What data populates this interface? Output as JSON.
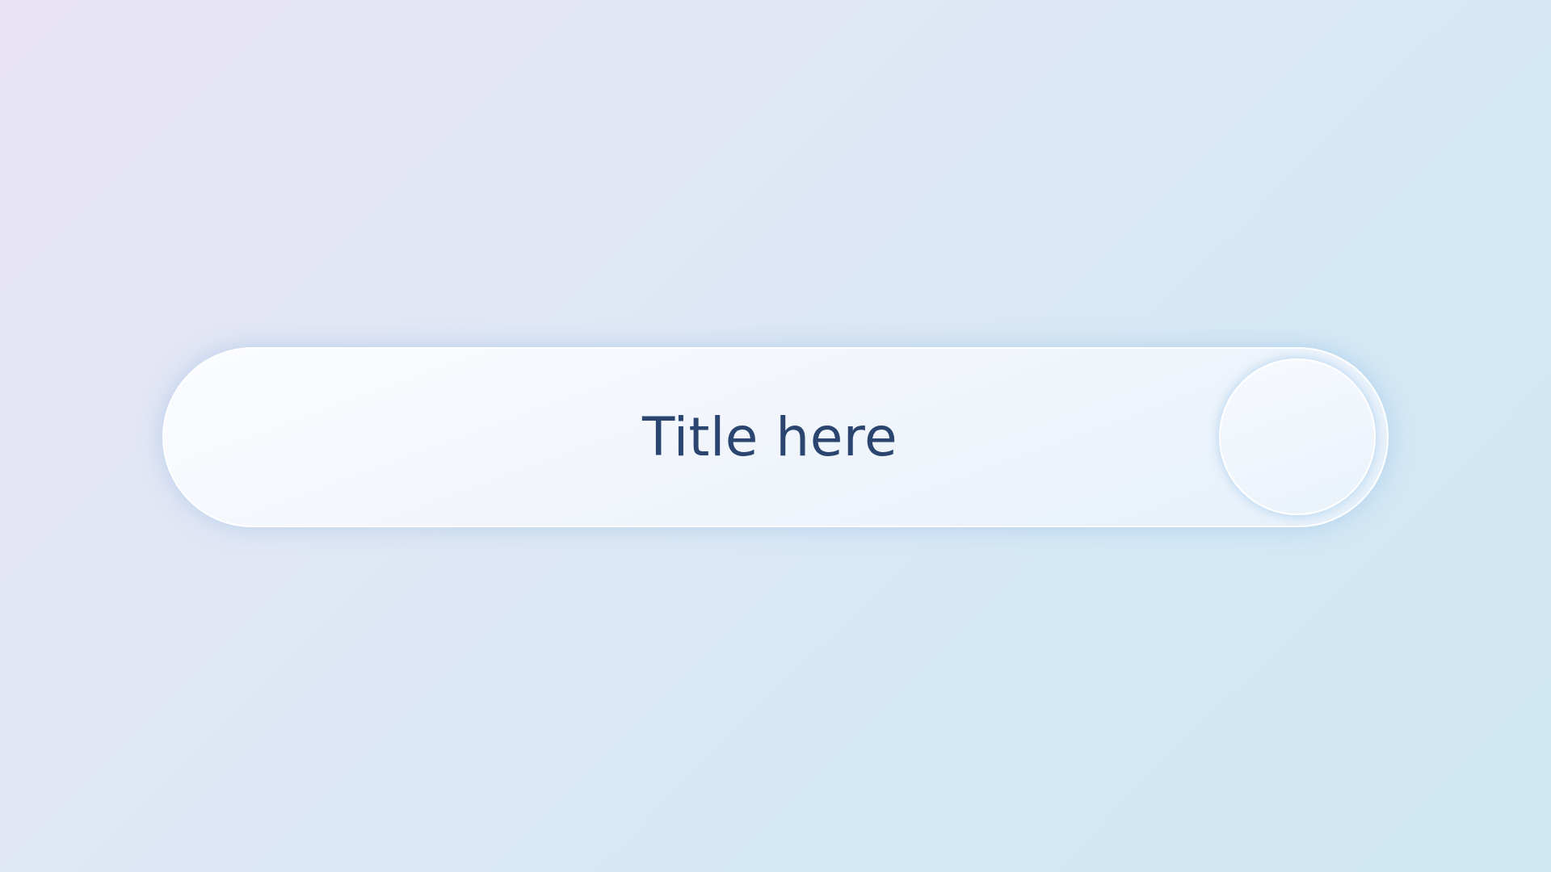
{
  "pill": {
    "title": "Title here"
  }
}
